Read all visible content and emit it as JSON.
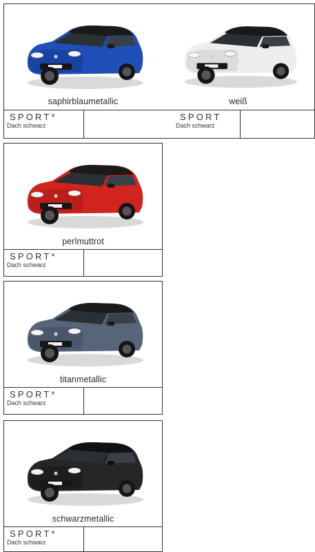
{
  "variants": [
    {
      "color_name": "saphirblaumetallic",
      "trim": "SPORT*",
      "roof": "Dach schwarz",
      "body_color": "#1f4fb8",
      "body_dark": "#0f2f7a",
      "roof_color": "#1a1a1a"
    },
    {
      "color_name": "weiß",
      "trim": "SPORT",
      "roof": "Dach schwarz",
      "body_color": "#eeeeee",
      "body_dark": "#b9b9b9",
      "roof_color": "#1a1a1a"
    },
    {
      "color_name": "perlmuttrot",
      "trim": "SPORT*",
      "roof": "Dach schwarz",
      "body_color": "#d1241e",
      "body_dark": "#8e1410",
      "roof_color": "#1a1a1a"
    },
    {
      "color_name": "titanmetallic",
      "trim": "SPORT*",
      "roof": "Dach schwarz",
      "body_color": "#56657a",
      "body_dark": "#343e4c",
      "roof_color": "#1a1a1a"
    },
    {
      "color_name": "schwarzmetallic",
      "trim": "SPORT*",
      "roof": "Dach schwarz",
      "body_color": "#262626",
      "body_dark": "#0d0d0d",
      "roof_color": "#111111"
    }
  ]
}
